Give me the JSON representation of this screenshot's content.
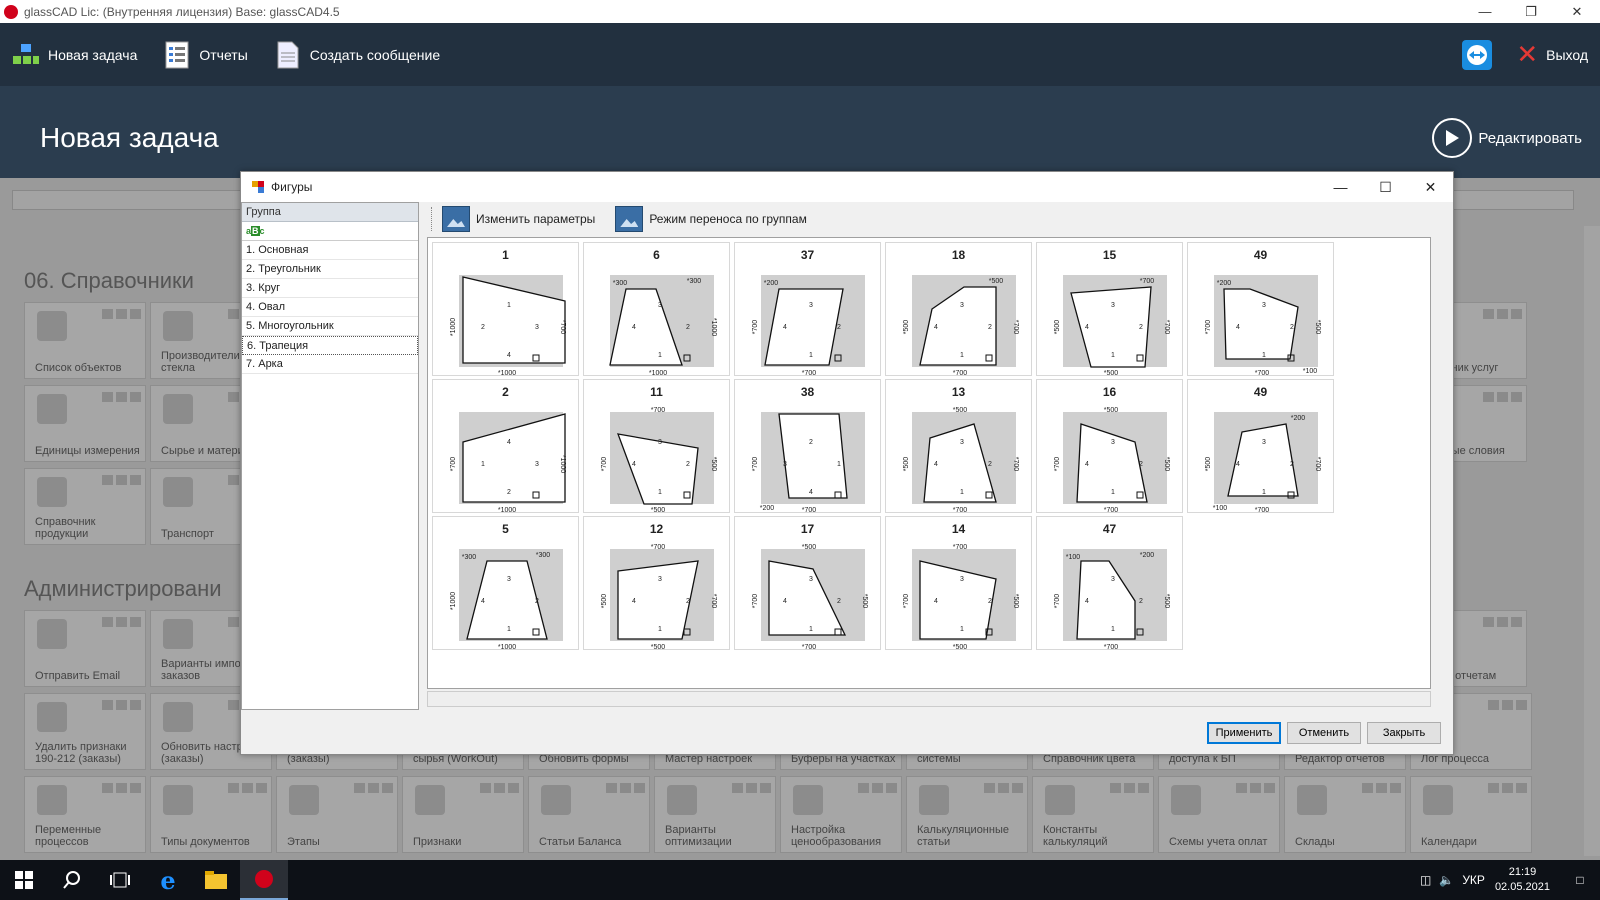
{
  "window": {
    "title": "glassCAD Lic: (Внутренняя лицензия) Base: glassCAD4.5"
  },
  "toolbar": {
    "new_task": "Новая задача",
    "reports": "Отчеты",
    "create_message": "Создать сообщение",
    "exit": "Выход"
  },
  "header": {
    "title": "Новая задача",
    "edit": "Редактировать"
  },
  "background": {
    "section_reference": "06. Справочники",
    "section_admin": "Администрировани",
    "tiles_top": [
      "Список объектов",
      "Производители стекла",
      "Единицы измерения",
      "Сырье и материалы",
      "Справочник продукции",
      "Транспорт"
    ],
    "tiles_right": [
      "правочник услуг",
      "редитные словия"
    ],
    "tiles_admin_row1": [
      "Отправить Email",
      "Варианты импо заказов",
      "оступ к отчетам"
    ],
    "tiles_admin_row2": [
      "Удалить признаки 190-212 (заказы)",
      "Обновить настройки (заказы)",
      "Обновить резервы (заказы)",
      "Обновить списание сырья (WorkOut)",
      "Обновить формы",
      "Мастер настроек",
      "Буферы на участках",
      "Общие настройки системы",
      "Справочник цвета",
      "Настройка прав доступа к БП",
      "Редактор отчетов",
      "Лог процесса"
    ],
    "tiles_admin_row3": [
      "Переменные процессов",
      "Типы документов",
      "Этапы",
      "Признаки",
      "Статьи Баланса",
      "Варианты оптимизации",
      "Настройка ценообразования",
      "Калькуляционные статьи",
      "Константы калькуляций",
      "Схемы учета оплат",
      "Склады",
      "Календари"
    ]
  },
  "dialog": {
    "title": "Фигуры",
    "group_header": "Группа",
    "filter_icon": "abc-filter-icon",
    "groups": [
      "1. Основная",
      "2. Треугольник",
      "3. Круг",
      "4. Овал",
      "5. Многоугольник",
      "6. Трапеция",
      "7. Арка"
    ],
    "selected_group": "6. Трапеция",
    "tool_change_params": "Изменить параметры",
    "tool_transfer_mode": "Режим переноса по группам",
    "shapes": [
      {
        "num": "1",
        "dims": {
          "top": "",
          "bottom": "*1000",
          "left": "*1000",
          "right": "*700"
        },
        "labels": [
          "1",
          "2",
          "3",
          "4"
        ]
      },
      {
        "num": "6",
        "dims": {
          "tl": "*300",
          "tr": "*300",
          "bottom": "*1000",
          "right": "*1000"
        },
        "labels": [
          "3",
          "4",
          "2",
          "1"
        ]
      },
      {
        "num": "37",
        "dims": {
          "tl": "*200",
          "bottom": "*700",
          "left": "*700"
        },
        "labels": [
          "3",
          "4",
          "2",
          "1"
        ]
      },
      {
        "num": "18",
        "dims": {
          "tr": "*500",
          "bottom": "*700",
          "left": "*500",
          "right": "*700"
        },
        "labels": [
          "3",
          "4",
          "2",
          "1"
        ]
      },
      {
        "num": "15",
        "dims": {
          "tr": "*700",
          "bottom": "*500",
          "left": "*500",
          "right": "*700"
        },
        "labels": [
          "3",
          "4",
          "2",
          "1"
        ]
      },
      {
        "num": "49",
        "dims": {
          "tl": "*200",
          "bottom": "*700",
          "left": "*700",
          "right": "*500",
          "br": "*100"
        },
        "labels": [
          "3",
          "4",
          "2",
          "1"
        ]
      },
      {
        "num": "2",
        "dims": {
          "bottom": "*1000",
          "left": "*700",
          "right": "*1000"
        },
        "labels": [
          "4",
          "1",
          "3",
          "2"
        ]
      },
      {
        "num": "11",
        "dims": {
          "top": "*700",
          "bottom": "*500",
          "left": "*700",
          "right": "*500"
        },
        "labels": [
          "3",
          "4",
          "2",
          "1"
        ]
      },
      {
        "num": "38",
        "dims": {
          "bl": "*200",
          "bottom": "*700",
          "left": "*700"
        },
        "labels": [
          "2",
          "3",
          "1",
          "4"
        ]
      },
      {
        "num": "13",
        "dims": {
          "top": "*500",
          "bottom": "*700",
          "left": "*500",
          "right": "*700"
        },
        "labels": [
          "3",
          "4",
          "2",
          "1"
        ]
      },
      {
        "num": "16",
        "dims": {
          "top": "*500",
          "bottom": "*700",
          "left": "*700",
          "right": "*500"
        },
        "labels": [
          "3",
          "4",
          "2",
          "1"
        ]
      },
      {
        "num": "49",
        "dims": {
          "tr": "*200",
          "bl": "*100",
          "bottom": "*700",
          "left": "*500",
          "right": "*700"
        },
        "labels": [
          "3",
          "4",
          "2",
          "1"
        ]
      },
      {
        "num": "5",
        "dims": {
          "tl": "*300",
          "tr": "*300",
          "bottom": "*1000",
          "left": "*1000"
        },
        "labels": [
          "3",
          "4",
          "2",
          "1"
        ]
      },
      {
        "num": "12",
        "dims": {
          "top": "*700",
          "bottom": "*500",
          "left": "*500",
          "right": "*700"
        },
        "labels": [
          "3",
          "4",
          "2",
          "1"
        ]
      },
      {
        "num": "17",
        "dims": {
          "top": "*500",
          "bottom": "*700",
          "left": "*700",
          "right": "*500"
        },
        "labels": [
          "3",
          "4",
          "2",
          "1"
        ]
      },
      {
        "num": "14",
        "dims": {
          "top": "*700",
          "bottom": "*500",
          "left": "*700",
          "right": "*500"
        },
        "labels": [
          "3",
          "4",
          "2",
          "1"
        ]
      },
      {
        "num": "47",
        "dims": {
          "tl": "*100",
          "tr": "*200",
          "bottom": "*700",
          "left": "*700",
          "right": "*500"
        },
        "labels": [
          "3",
          "4",
          "2",
          "1"
        ]
      }
    ],
    "buttons": {
      "apply": "Применить",
      "cancel": "Отменить",
      "close": "Закрыть"
    }
  },
  "taskbar": {
    "lang": "УКР",
    "time": "21:19",
    "date": "02.05.2021"
  }
}
